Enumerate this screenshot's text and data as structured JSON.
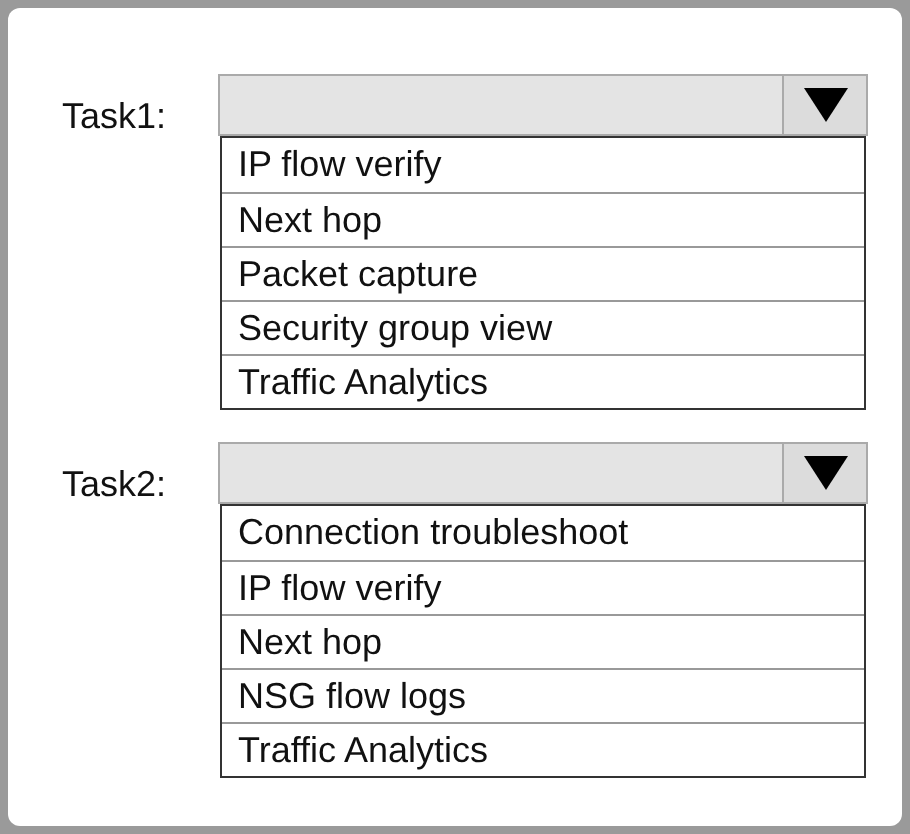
{
  "tasks": [
    {
      "label": "Task1:",
      "options": [
        "IP flow verify",
        "Next hop",
        "Packet capture",
        "Security group view",
        "Traffic Analytics"
      ]
    },
    {
      "label": "Task2:",
      "options": [
        "Connection troubleshoot",
        "IP flow verify",
        "Next hop",
        "NSG flow logs",
        "Traffic Analytics"
      ]
    }
  ]
}
